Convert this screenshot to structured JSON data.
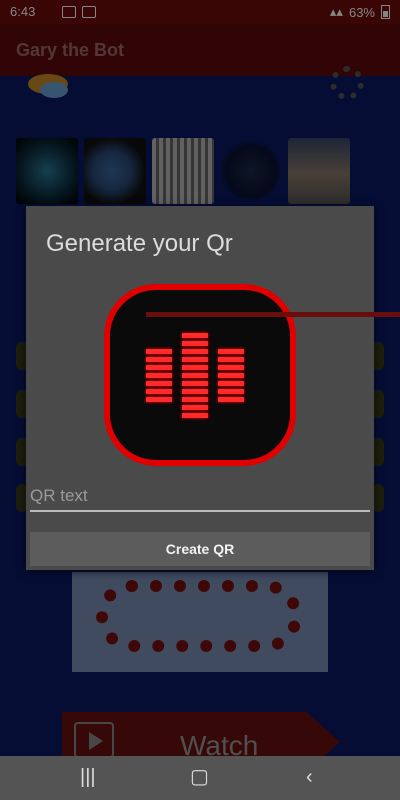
{
  "status_bar": {
    "time": "6:43",
    "battery": "63%"
  },
  "app": {
    "title": "Gary the Bot"
  },
  "dialog": {
    "title": "Generate your Qr",
    "input_placeholder": "QR text",
    "create_label": "Create QR"
  },
  "background": {
    "watch_label": "Watch"
  },
  "icons": {
    "status": [
      "image-icon",
      "wifi-icon",
      "bluetooth-icon",
      "signal-icon",
      "battery-icon"
    ],
    "nav": [
      "recents-icon",
      "home-icon",
      "back-icon"
    ]
  },
  "colors": {
    "accent": "#e00000",
    "dialog_bg": "#4a4a4a",
    "button_bg": "#5c5c5c"
  }
}
